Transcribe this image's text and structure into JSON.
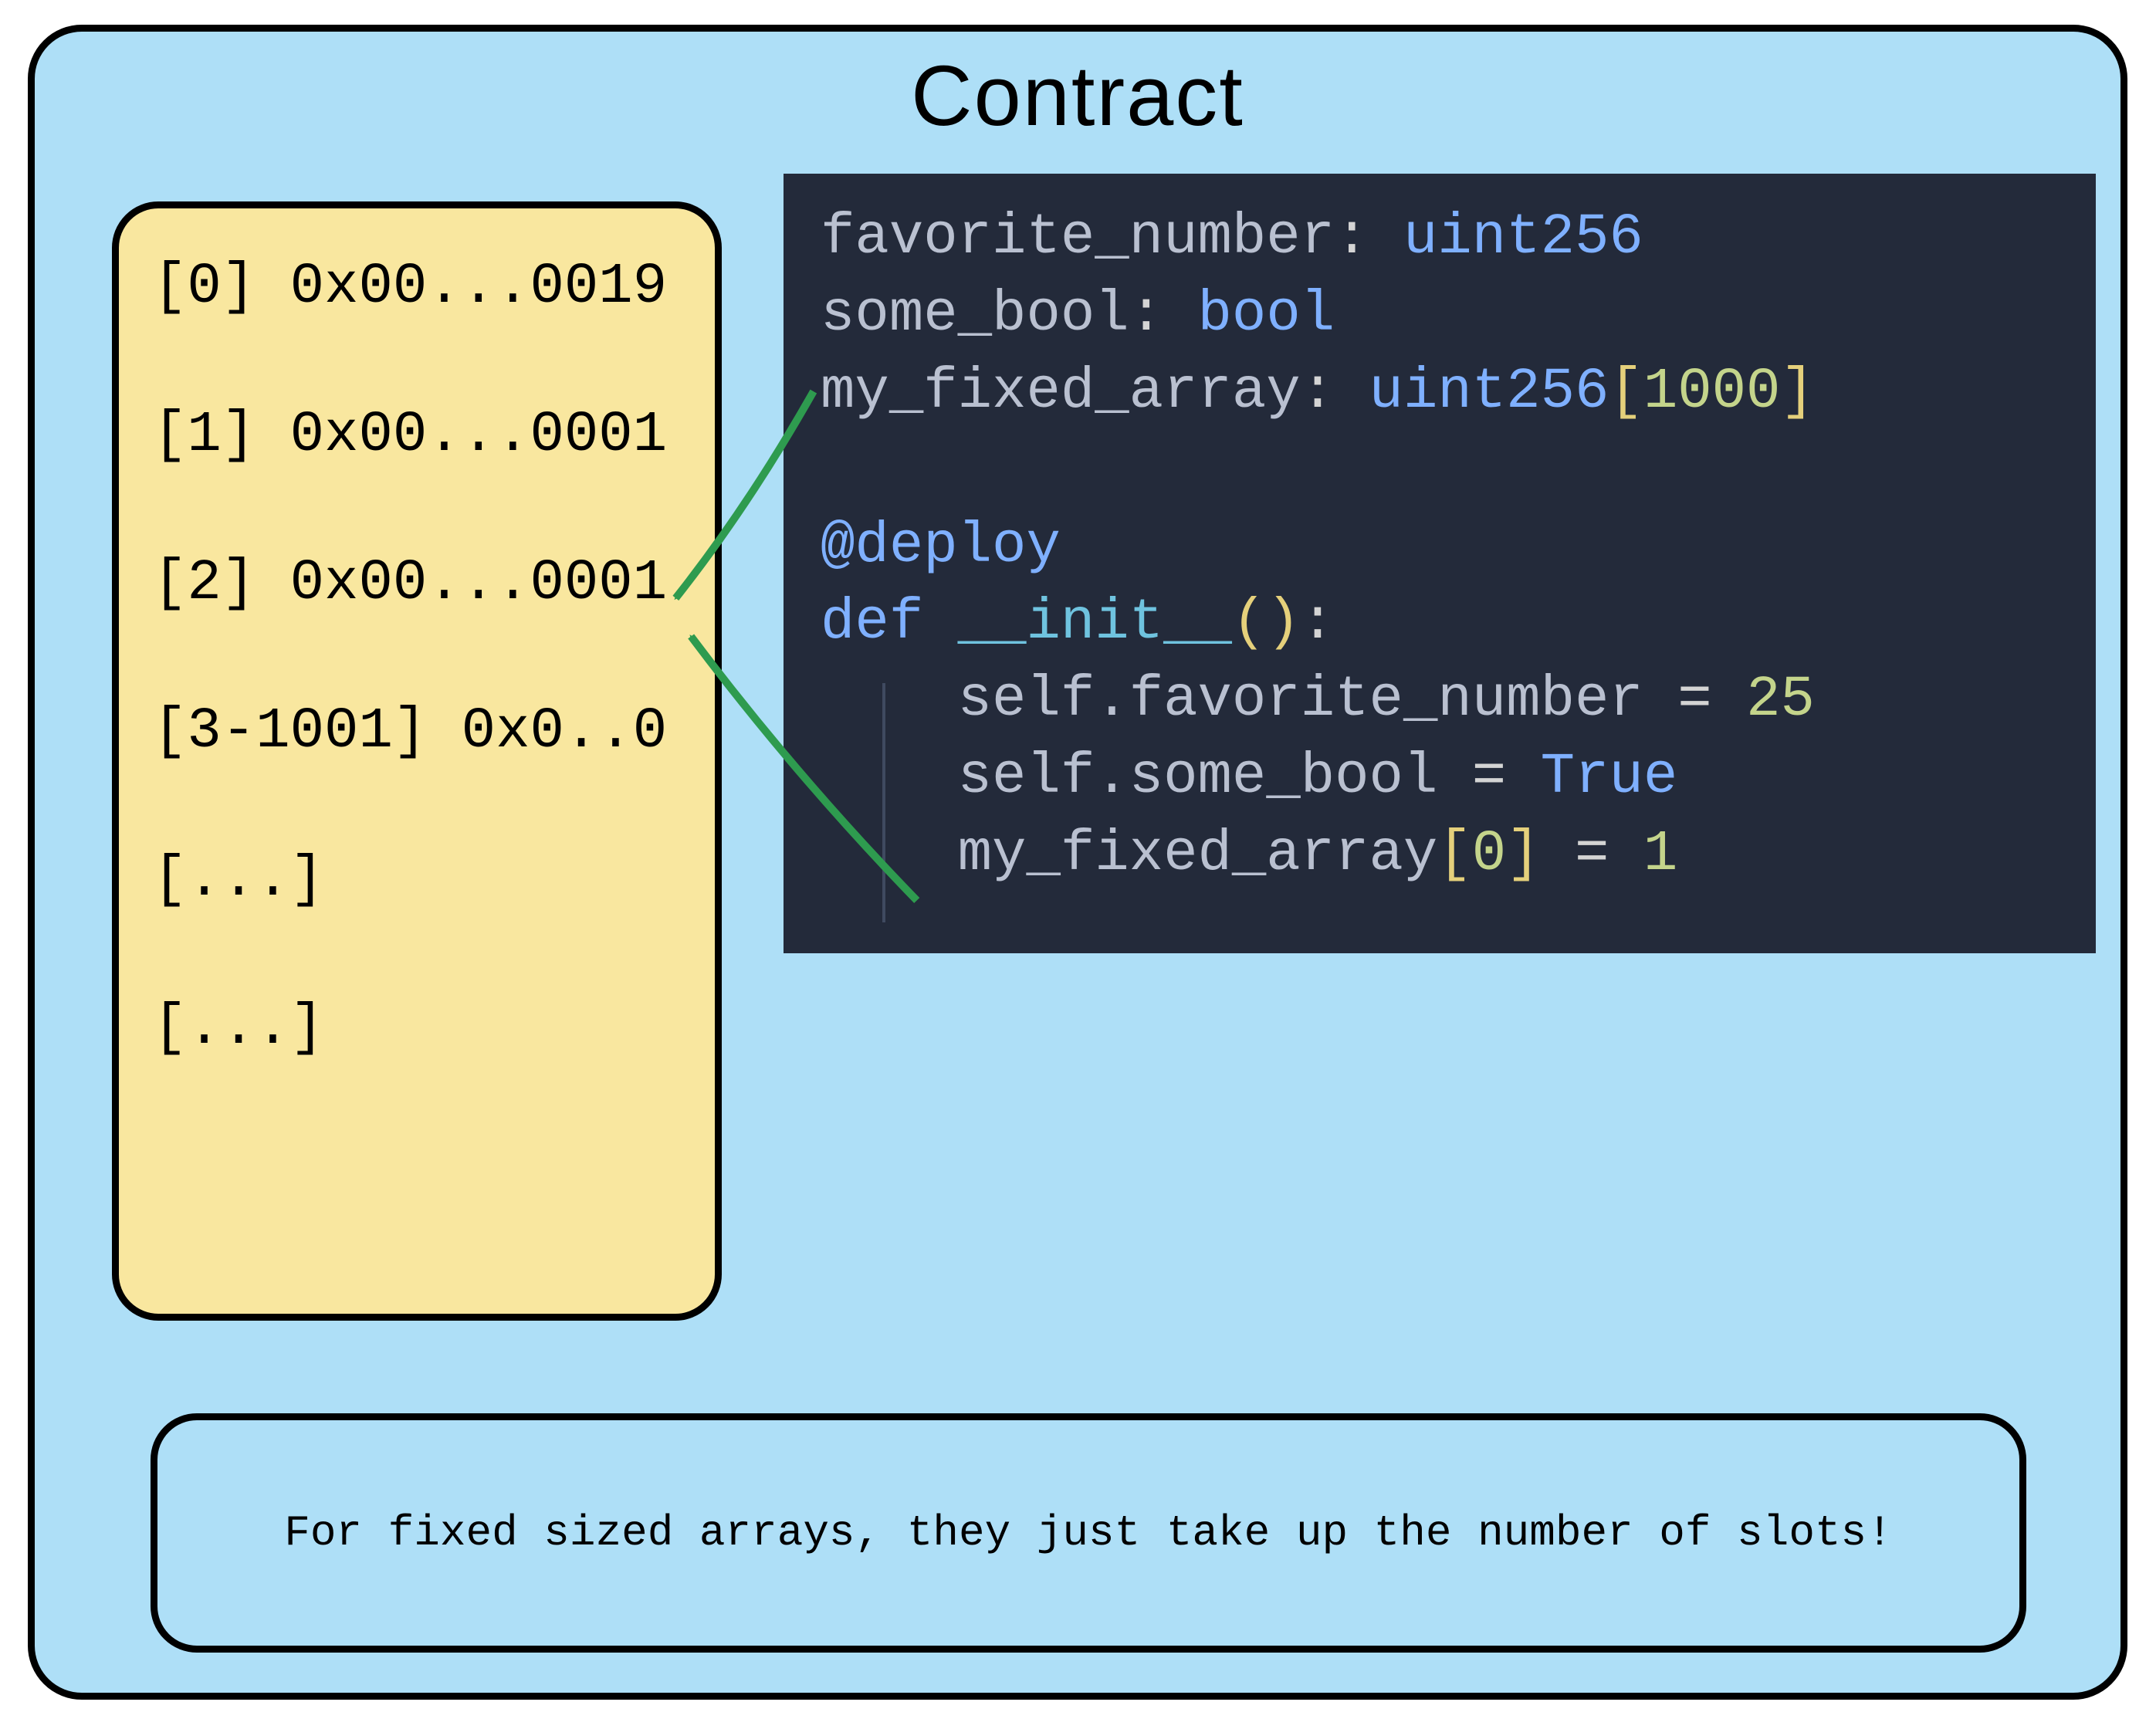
{
  "title": "Contract",
  "storage": {
    "rows": [
      "[0] 0x00...0019",
      "[1] 0x00...0001",
      "[2] 0x00...0001",
      "[3-1001] 0x0..0",
      "[...]",
      "[...]"
    ]
  },
  "code": {
    "decl": {
      "fav_name": "favorite_number",
      "fav_type": "uint256",
      "bool_name": "some_bool",
      "bool_type": "bool",
      "arr_name": "my_fixed_array",
      "arr_type": "uint256",
      "arr_size": "1000"
    },
    "decorator": "@deploy",
    "def_kw": "def",
    "fn_name": "__init__",
    "body": {
      "self": "self",
      "fav_prop": "favorite_number",
      "fav_val": "25",
      "bool_prop": "some_bool",
      "bool_val": "True",
      "arr_prop": "my_fixed_array",
      "arr_index": "0",
      "arr_val": "1"
    }
  },
  "caption": "For fixed sized arrays, they just take up the number of slots!",
  "colors": {
    "panel_bg": "#aedff7",
    "storage_bg": "#f9e79f",
    "code_bg": "#232a3a",
    "arrow": "#2e9b4f"
  }
}
